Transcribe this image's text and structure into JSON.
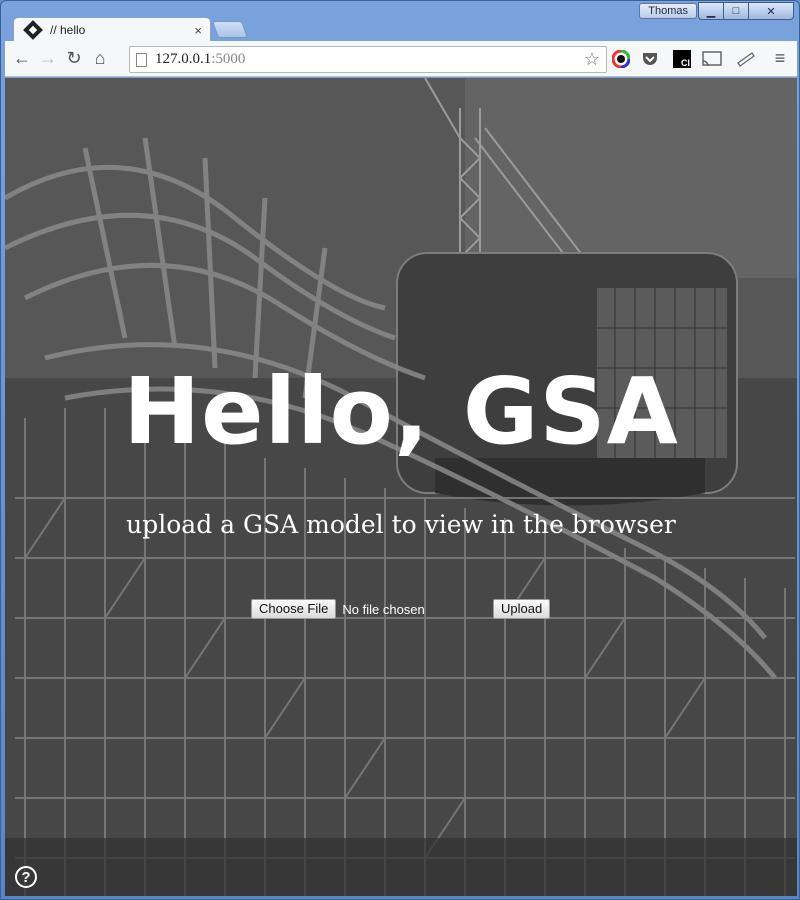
{
  "window": {
    "user": "Thomas",
    "minimize_icon": "minimize-icon",
    "maximize_icon": "maximize-icon",
    "close_icon": "close-icon"
  },
  "tab": {
    "title": "// hello",
    "close": "×"
  },
  "toolbar": {
    "back": "←",
    "forward": "→",
    "reload": "↻",
    "home": "⌂",
    "url_host": "127.0.0.1",
    "url_port": ":5000",
    "star": "☆",
    "menu": "≡"
  },
  "page": {
    "title": "Hello, GSA",
    "subtitle": "upload a GSA model to view in the browser",
    "choose_file_label": "Choose File",
    "no_file_text": "No file chosen",
    "upload_label": "Upload",
    "help": "?"
  }
}
